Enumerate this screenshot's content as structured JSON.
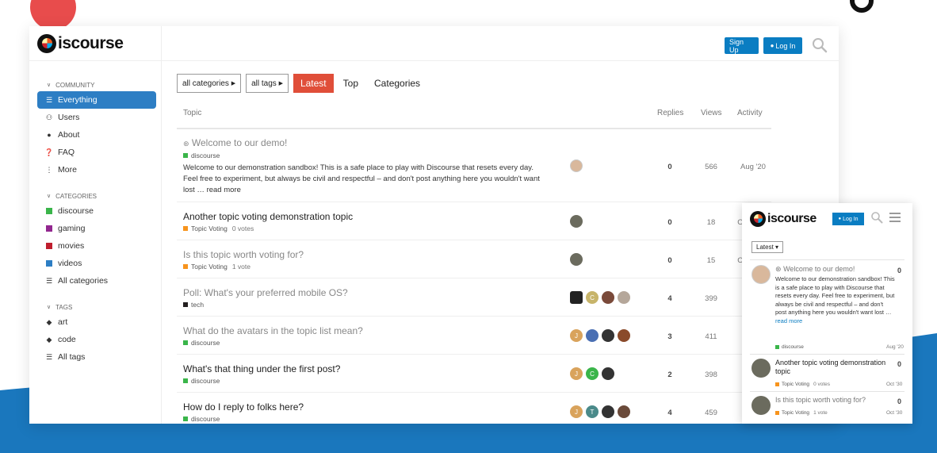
{
  "brand": {
    "name": "iscourse",
    "accent": "#2d7ec4",
    "primary_button": "#0a7dc2",
    "latest_color": "#e04e39"
  },
  "header": {
    "signup_label": "Sign Up",
    "login_label": "Log In"
  },
  "sidebar": {
    "community_label": "COMMUNITY",
    "community_items": [
      {
        "label": "Everything",
        "icon": "layers-icon"
      },
      {
        "label": "Users",
        "icon": "users-icon"
      },
      {
        "label": "About",
        "icon": "info-icon"
      },
      {
        "label": "FAQ",
        "icon": "question-icon"
      },
      {
        "label": "More",
        "icon": "ellipsis-icon"
      }
    ],
    "categories_label": "CATEGORIES",
    "categories": [
      {
        "label": "discourse",
        "color": "#3ab54a"
      },
      {
        "label": "gaming",
        "color": "#92278f"
      },
      {
        "label": "movies",
        "color": "#bf1e2e"
      },
      {
        "label": "videos",
        "color": "#2d7ec4"
      }
    ],
    "all_categories_label": "All categories",
    "tags_label": "TAGS",
    "tags": [
      {
        "label": "art"
      },
      {
        "label": "code"
      }
    ],
    "all_tags_label": "All tags"
  },
  "nav": {
    "categories_dropdown": "all categories",
    "tags_dropdown": "all tags",
    "latest": "Latest",
    "top": "Top",
    "categories": "Categories"
  },
  "columns": {
    "topic": "Topic",
    "replies": "Replies",
    "views": "Views",
    "activity": "Activity"
  },
  "topics": [
    {
      "title": "Welcome to our demo!",
      "category": "discourse",
      "cat_color": "#3ab54a",
      "extra": "",
      "excerpt": "Welcome to our demonstration sandbox! This is a safe place to play with Discourse that resets every day. Feel free to experiment, but always be civil and respectful – and don't post anything here you wouldn't want lost … ",
      "more": "read more",
      "replies": "0",
      "views": "566",
      "activity": "Aug '20"
    },
    {
      "title": "Another topic voting demonstration topic",
      "category": "Topic Voting",
      "cat_color": "#f7941d",
      "extra": "0 votes",
      "replies": "0",
      "views": "18",
      "activity": "O"
    },
    {
      "title": "Is this topic worth voting for?",
      "category": "Topic Voting",
      "cat_color": "#f7941d",
      "extra": "1 vote",
      "replies": "0",
      "views": "15",
      "activity": "O"
    },
    {
      "title": "Poll: What's your preferred mobile OS?",
      "category": "tech",
      "cat_color": "#231f20",
      "extra": "",
      "replies": "4",
      "views": "399",
      "activity": ""
    },
    {
      "title": "What do the avatars in the topic list mean?",
      "category": "discourse",
      "cat_color": "#3ab54a",
      "extra": "",
      "replies": "3",
      "views": "411",
      "activity": ""
    },
    {
      "title": "What's that thing under the first post?",
      "category": "discourse",
      "cat_color": "#3ab54a",
      "extra": "",
      "replies": "2",
      "views": "398",
      "activity": ""
    },
    {
      "title": "How do I reply to folks here?",
      "category": "discourse",
      "cat_color": "#3ab54a",
      "extra": "",
      "replies": "4",
      "views": "459",
      "activity": ""
    }
  ],
  "avatars": {
    "row4": [
      "",
      "C",
      "",
      ""
    ],
    "row5": [
      "J",
      "",
      "",
      ""
    ],
    "row6": [
      "J",
      "C",
      ""
    ],
    "row7": [
      "J",
      "T",
      "",
      ""
    ]
  },
  "mobile": {
    "login_label": "Log In",
    "latest_label": "Latest",
    "topics": [
      {
        "title": "Welcome to our demo!",
        "count": "0",
        "excerpt": "Welcome to our demonstration sandbox! This is a safe place to play with Discourse that resets every day. Feel free to experiment, but always be civil and respectful – and don't post anything here you wouldn't want lost …",
        "more": "read more",
        "category": "discourse",
        "extra": "",
        "date": "Aug '20"
      },
      {
        "title": "Another topic voting demonstration topic",
        "count": "0",
        "category": "Topic Voting",
        "extra": "0 votes",
        "date": "Oct '30"
      },
      {
        "title": "Is this topic worth voting for?",
        "count": "0",
        "category": "Topic Voting",
        "extra": "1 vote",
        "date": "Oct '30"
      }
    ]
  }
}
